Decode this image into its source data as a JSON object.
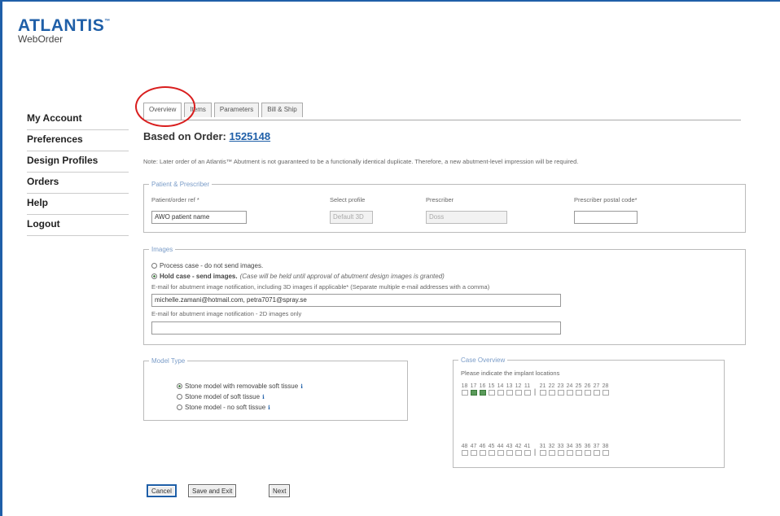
{
  "brand": {
    "name": "ATLANTIS",
    "tm": "™",
    "product": "WebOrder"
  },
  "nav": [
    {
      "label": "My Account"
    },
    {
      "label": "Preferences"
    },
    {
      "label": "Design Profiles"
    },
    {
      "label": "Orders"
    },
    {
      "label": "Help"
    },
    {
      "label": "Logout"
    }
  ],
  "tabs": [
    {
      "label": "Overview",
      "active": true
    },
    {
      "label": "Items"
    },
    {
      "label": "Parameters"
    },
    {
      "label": "Bill & Ship"
    }
  ],
  "order": {
    "prefix": "Based on Order:",
    "number": "1525148"
  },
  "note": "Note: Later order of an Atlantis™ Abutment is not guaranteed to be a functionally identical duplicate. Therefore, a new abutment-level impression will be required.",
  "patient": {
    "legend": "Patient & Prescriber",
    "patient_label": "Patient/order ref *",
    "patient_value": "AWO patient name",
    "profile_label": "Select profile",
    "profile_value": "Default 3D",
    "prescriber_label": "Prescriber",
    "prescriber_value": "Doss",
    "postal_label": "Prescriber postal code*",
    "postal_value": ""
  },
  "images": {
    "legend": "Images",
    "option1": "Process case - do not send images.",
    "option2_bold": "Hold case - send images.",
    "option2_note": "(Case will be held until approval of abutment design images is granted)",
    "email3d_label": "E-mail for abutment image notification, including 3D images if applicable* (Separate multiple e-mail addresses with a comma)",
    "email3d_value": "michelle.zamani@hotmail.com, petra7071@spray.se",
    "email2d_label": "E-mail for abutment image notification - 2D images only",
    "email2d_value": ""
  },
  "model": {
    "legend": "Model Type",
    "options": [
      {
        "label": "Stone model with removable soft tissue",
        "selected": true
      },
      {
        "label": "Stone model of soft tissue",
        "selected": false
      },
      {
        "label": "Stone model - no soft tissue",
        "selected": false
      }
    ],
    "info_icon": "info-icon"
  },
  "case": {
    "legend": "Case Overview",
    "instruction": "Please indicate the implant locations",
    "upper_left": [
      {
        "n": "18",
        "on": false
      },
      {
        "n": "17",
        "on": true
      },
      {
        "n": "16",
        "on": true
      },
      {
        "n": "15",
        "on": false
      },
      {
        "n": "14",
        "on": false
      },
      {
        "n": "13",
        "on": false
      },
      {
        "n": "12",
        "on": false
      },
      {
        "n": "11",
        "on": false
      }
    ],
    "upper_right": [
      {
        "n": "21",
        "on": false
      },
      {
        "n": "22",
        "on": false
      },
      {
        "n": "23",
        "on": false
      },
      {
        "n": "24",
        "on": false
      },
      {
        "n": "25",
        "on": false
      },
      {
        "n": "26",
        "on": false
      },
      {
        "n": "27",
        "on": false
      },
      {
        "n": "28",
        "on": false
      }
    ],
    "lower_left": [
      {
        "n": "48",
        "on": false
      },
      {
        "n": "47",
        "on": false
      },
      {
        "n": "46",
        "on": false
      },
      {
        "n": "45",
        "on": false
      },
      {
        "n": "44",
        "on": false
      },
      {
        "n": "43",
        "on": false
      },
      {
        "n": "42",
        "on": false
      },
      {
        "n": "41",
        "on": false
      }
    ],
    "lower_right": [
      {
        "n": "31",
        "on": false
      },
      {
        "n": "32",
        "on": false
      },
      {
        "n": "33",
        "on": false
      },
      {
        "n": "34",
        "on": false
      },
      {
        "n": "35",
        "on": false
      },
      {
        "n": "36",
        "on": false
      },
      {
        "n": "37",
        "on": false
      },
      {
        "n": "38",
        "on": false
      }
    ],
    "separator": "|"
  },
  "buttons": {
    "cancel": "Cancel",
    "save_exit": "Save and Exit",
    "next": "Next"
  },
  "colors": {
    "brand": "#1f5fa8",
    "highlight_circle": "#d91e1e",
    "selected_tooth": "#5a9a5a"
  }
}
